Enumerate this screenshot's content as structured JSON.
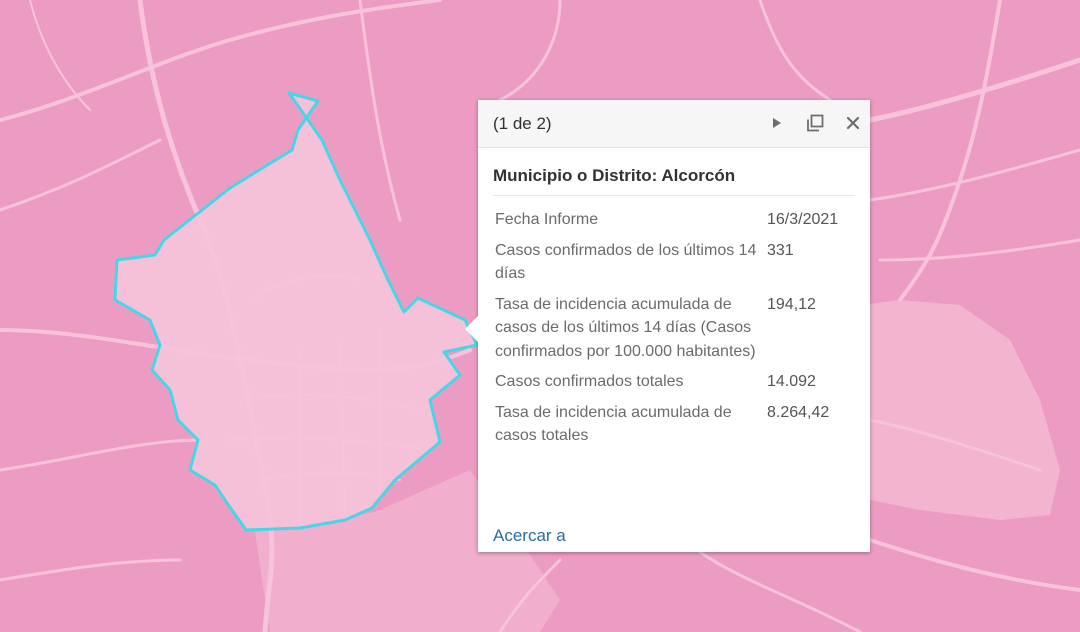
{
  "map": {
    "basemap_color": "#ec9cc2",
    "road_color": "#f6c3da",
    "highlight_outline_color": "#46d6e8"
  },
  "popup": {
    "pager": "(1 de 2)",
    "next_icon": "play-triangle",
    "dock_icon": "maximize-square",
    "close_icon": "x",
    "title": "Municipio o Distrito: Alcorcón",
    "fields": [
      {
        "label": "Fecha Informe",
        "value": "16/3/2021"
      },
      {
        "label": "Casos confirmados de los últimos 14 días",
        "value": "331"
      },
      {
        "label": "Tasa de incidencia acumulada de casos de los últimos 14 días (Casos confirmados por 100.000 habitantes)",
        "value": "194,12"
      },
      {
        "label": "Casos confirmados totales",
        "value": "14.092"
      },
      {
        "label": "Tasa de incidencia acumulada de casos totales",
        "value": "8.264,42"
      }
    ],
    "zoom_link": "Acercar a"
  }
}
